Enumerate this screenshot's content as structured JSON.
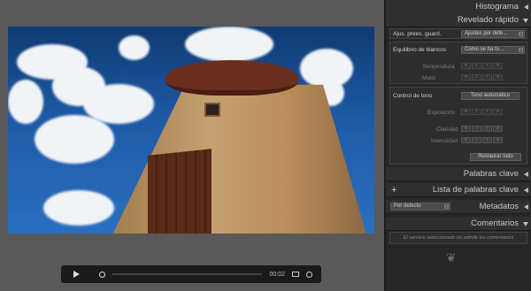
{
  "video": {
    "time": "00:02"
  },
  "panel": {
    "histogram": "Histograma",
    "quick_develop": "Revelado rápido",
    "saved_preset_label": "Ajus. prees. guard.",
    "saved_preset_value": "Ajustes por defe...",
    "white_balance_label": "Equilibrio de blancos",
    "white_balance_value": "Como se ha to...",
    "temperature_label": "Temperatura",
    "tint_label": "Matiz",
    "tone_control_label": "Control de tono",
    "auto_tone_button": "Tono automático",
    "exposure_label": "Exposición",
    "clarity_label": "Claridad",
    "vibrance_label": "Intensidad",
    "reset_button": "Restaurar todo",
    "keywords": "Palabras clave",
    "keyword_list": "Lista de palabras clave",
    "metadata_preset": "Por defecto",
    "metadata": "Metadatos",
    "comments": "Comentarios",
    "comments_note": "El servicio seleccionado no admite los comentarios"
  },
  "colors": {
    "panel_bg": "#262626",
    "app_bg": "#595959",
    "controller_bg": "#1a1a1a"
  }
}
